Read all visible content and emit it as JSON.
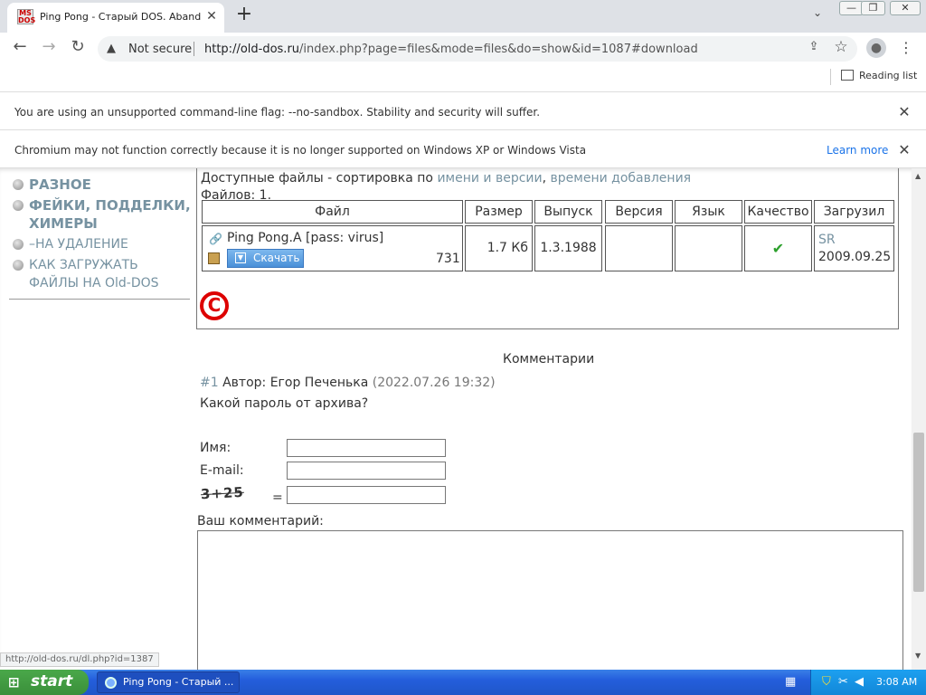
{
  "browser": {
    "tab": {
      "favicon_lines": [
        "MS",
        "DOS"
      ],
      "title": "Ping Pong - Старый DOS. Abandonware",
      "close": "✕"
    },
    "new_tab": "+",
    "window_buttons": {
      "minimize": "—",
      "restore": "❐",
      "close": "✕"
    },
    "tab_search": "⌄",
    "nav": {
      "back": "←",
      "forward": "→",
      "reload": "↻"
    },
    "omnibox": {
      "warning": "▲",
      "not_secure": "Not secure",
      "url_host": "http://old-dos.ru",
      "url_path": "/index.php?page=files&mode=files&do=show&id=1087#download"
    },
    "share": "⇪",
    "star": "☆",
    "profile": "●",
    "menu": "⋮",
    "reading_list": "Reading list",
    "infobar1": {
      "message": "You are using an unsupported command-line flag: --no-sandbox. Stability and security will suffer.",
      "close": "✕"
    },
    "infobar2": {
      "message": "Chromium may not function correctly because it is no longer supported on Windows XP or Windows Vista",
      "learn_more": "Learn more",
      "close": "✕"
    },
    "status_url": "http://old-dos.ru/dl.php?id=1387"
  },
  "sidebar": {
    "items": [
      {
        "label": "РАЗНОЕ"
      },
      {
        "label": "ФЕЙКИ, ПОДДЕЛКИ, ХИМЕРЫ"
      },
      {
        "label": "–НА УДАЛЕНИЕ"
      },
      {
        "label": "КАК ЗАГРУЖАТЬ ФАЙЛЫ НА Old-DOS"
      }
    ]
  },
  "files": {
    "header_prefix": "Доступные файлы - сортировка по",
    "sort_name": "имени и версии",
    "comma": ",",
    "sort_time": "времени добавления",
    "count": "Файлов: 1.",
    "columns": [
      "Файл",
      "Размер",
      "Выпуск",
      "Версия",
      "Язык",
      "Качество",
      "Загрузил"
    ],
    "row": {
      "name": "Ping Pong.A [pass: virus]",
      "download": "Скачать",
      "downloads": "731",
      "size": "1.7 Кб",
      "release": "1.3.1988",
      "version": "",
      "language": "",
      "quality": "✔",
      "uploader": "SR",
      "date": "2009.09.25"
    },
    "copyright": "C"
  },
  "comments": {
    "title": "Комментарии",
    "items": [
      {
        "num": "#1",
        "author_label": "Автор:",
        "author": "Егор Печенька",
        "date": "(2022.07.26 19:32)",
        "text": "Какой пароль от архива?"
      }
    ],
    "form": {
      "name_label": "Имя:",
      "email_label": "E-mail:",
      "captcha": "3+25",
      "equals": "=",
      "comment_label": "Ваш комментарий:"
    }
  },
  "taskbar": {
    "start": "start",
    "task": "Ping Pong - Старый ...",
    "clock": "3:08 AM"
  }
}
